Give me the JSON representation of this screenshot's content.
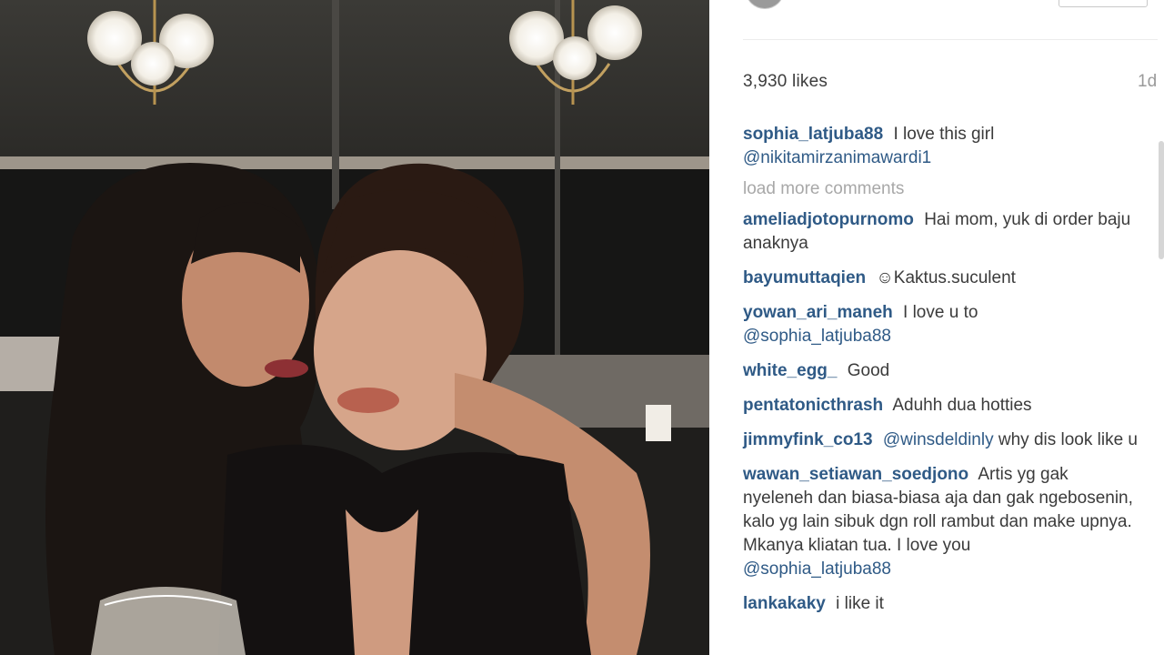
{
  "post": {
    "likes": "3,930 likes",
    "time": "1d",
    "load_more": "load more comments"
  },
  "comments": [
    {
      "user": "sophia_latjuba88",
      "text": "I love this girl",
      "mention": "@nikitamirzanimawardi1"
    },
    {
      "user": "ameliadjotopurnomo",
      "text": "Hai mom, yuk di order baju anaknya",
      "mention": ""
    },
    {
      "user": "bayumuttaqien",
      "text": "☺Kaktus.suculent",
      "mention": ""
    },
    {
      "user": "yowan_ari_maneh",
      "text": "I love u to",
      "mention": "@sophia_latjuba88"
    },
    {
      "user": "white_egg_",
      "text": "Good",
      "mention": ""
    },
    {
      "user": "pentatonicthrash",
      "text": "Aduhh dua hotties",
      "mention": ""
    },
    {
      "user": "jimmyfink_co13",
      "mention_first": "@winsdeldinly",
      "text": "why dis look like u"
    },
    {
      "user": "wawan_setiawan_soedjono",
      "text": "Artis yg gak nyeleneh dan biasa-biasa aja dan gak ngebosenin, kalo yg lain sibuk dgn roll rambut dan make upnya. Mkanya kliatan tua. I love you",
      "mention": "@sophia_latjuba88"
    },
    {
      "user": "lankakaky",
      "text": "i like it",
      "mention": ""
    }
  ],
  "colors": {
    "username": "#2f5a86",
    "text": "#3b3b3b",
    "muted": "#a8a8a8"
  }
}
